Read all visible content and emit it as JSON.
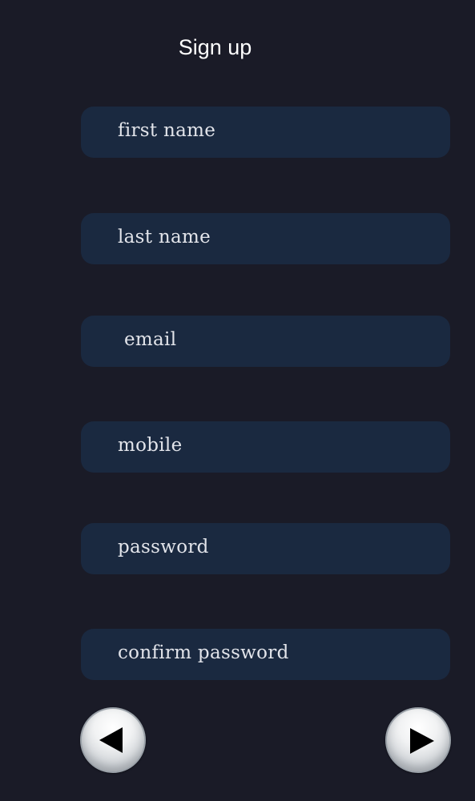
{
  "header": {
    "title": "Sign up"
  },
  "form": {
    "fields": [
      {
        "placeholder": "first name",
        "value": ""
      },
      {
        "placeholder": "last name",
        "value": ""
      },
      {
        "placeholder": "email",
        "value": ""
      },
      {
        "placeholder": "mobile",
        "value": ""
      },
      {
        "placeholder": "password",
        "value": ""
      },
      {
        "placeholder": "confirm password",
        "value": ""
      }
    ]
  },
  "navigation": {
    "prev_icon": "triangle-left-icon",
    "next_icon": "triangle-right-icon"
  },
  "colors": {
    "background": "#1a1b27",
    "field_background": "#1a2940",
    "title_text": "#ffffff",
    "field_text": "#e2e4ea"
  }
}
